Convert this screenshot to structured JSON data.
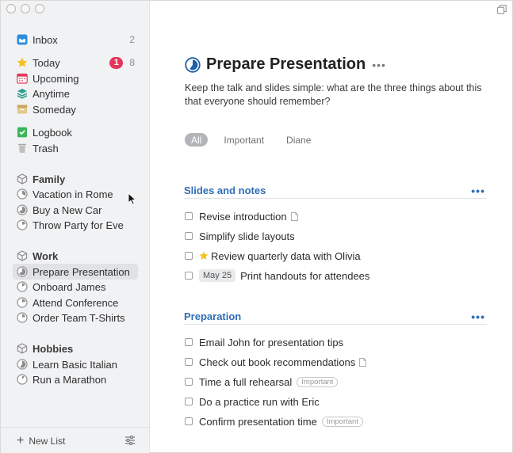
{
  "sidebar": {
    "lists": [
      {
        "label": "Inbox",
        "count": "2",
        "icon": "inbox-icon",
        "color": "#2b8de0"
      },
      {
        "label": "Today",
        "badge": "1",
        "count": "8",
        "icon": "star-icon",
        "color": "#f5c021"
      },
      {
        "label": "Upcoming",
        "icon": "calendar-icon",
        "color": "#e3395a"
      },
      {
        "label": "Anytime",
        "icon": "layers-icon",
        "color": "#2f9e8f"
      },
      {
        "label": "Someday",
        "icon": "archive-box-icon",
        "color": "#d3b26a"
      },
      {
        "label": "Logbook",
        "icon": "checkbook-icon",
        "color": "#3bb55a"
      },
      {
        "label": "Trash",
        "icon": "trash-icon",
        "color": "#9a9a9a"
      }
    ],
    "areas": [
      {
        "label": "Family",
        "projects": [
          "Vacation in Rome",
          "Buy a New Car",
          "Throw Party for Eve"
        ]
      },
      {
        "label": "Work",
        "projects": [
          "Prepare Presentation",
          "Onboard James",
          "Attend Conference",
          "Order Team T-Shirts"
        ]
      },
      {
        "label": "Hobbies",
        "projects": [
          "Learn Basic Italian",
          "Run a Marathon"
        ]
      }
    ],
    "selected_project": "Prepare Presentation",
    "new_list_label": "New List"
  },
  "project": {
    "title": "Prepare Presentation",
    "progress": 0.6,
    "notes": "Keep the talk and slides simple: what are the three things about this that everyone should remember?",
    "tags": [
      "All",
      "Important",
      "Diane"
    ],
    "active_tag": "All",
    "headings": [
      {
        "title": "Slides and notes",
        "todos": [
          {
            "text": "Revise introduction",
            "has_note": true
          },
          {
            "text": "Simplify slide layouts"
          },
          {
            "text": "Review quarterly data with Olivia",
            "starred": true
          },
          {
            "text": "Print handouts for attendees",
            "date": "May 25"
          }
        ]
      },
      {
        "title": "Preparation",
        "todos": [
          {
            "text": "Email John for presentation tips"
          },
          {
            "text": "Check out book recommendations",
            "has_note": true
          },
          {
            "text": "Time a full rehearsal",
            "tag": "Important"
          },
          {
            "text": "Do a practice run with Eric"
          },
          {
            "text": "Confirm presentation time",
            "tag": "Important"
          }
        ]
      }
    ]
  },
  "colors": {
    "accent": "#2f6db5",
    "badge": "#e5355a",
    "sidebar_bg": "#f1f2f4"
  }
}
